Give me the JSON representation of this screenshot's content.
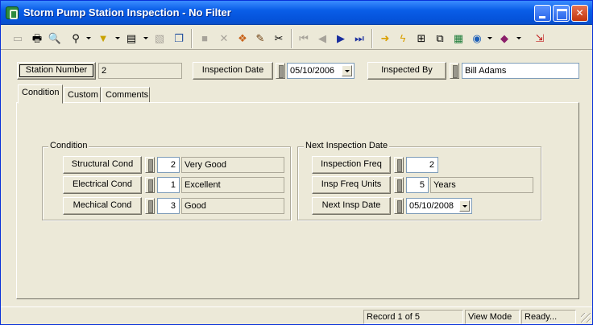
{
  "window": {
    "title": "Storm Pump Station Inspection - No Filter"
  },
  "toolbar": {
    "icons": [
      "save-icon",
      "print-icon",
      "print-preview-icon",
      "find-icon",
      "filter-icon",
      "view-icon",
      "properties-icon",
      "copy-form-icon",
      "delete-disabled-icon",
      "delete-icon",
      "attach-icon",
      "edit-icon",
      "cut-icon",
      "first-record-icon",
      "previous-record-icon",
      "next-record-icon",
      "last-record-icon",
      "new-record-icon",
      "lightning-icon",
      "structure-icon",
      "relations-icon",
      "map-icon",
      "globe-icon",
      "book-icon",
      "exit-icon"
    ]
  },
  "header": {
    "station_number_label": "Station Number",
    "station_number_value": "2",
    "inspection_date_label": "Inspection Date",
    "inspection_date_value": "05/10/2006",
    "inspected_by_label": "Inspected By",
    "inspected_by_value": "Bill Adams"
  },
  "tabs": [
    {
      "label": "Condition",
      "active": true
    },
    {
      "label": "Custom",
      "active": false
    },
    {
      "label": "Comments",
      "active": false
    }
  ],
  "condition": {
    "title": "Condition",
    "rows": [
      {
        "label": "Structural Cond",
        "code": "2",
        "text": "Very Good"
      },
      {
        "label": "Electrical Cond",
        "code": "1",
        "text": "Excellent"
      },
      {
        "label": "Mechical Cond",
        "code": "3",
        "text": "Good"
      }
    ]
  },
  "next_inspection": {
    "title": "Next Inspection Date",
    "freq_label": "Inspection Freq",
    "freq_value": "2",
    "units_label": "Insp Freq Units",
    "units_code": "5",
    "units_text": "Years",
    "next_label": "Next Insp Date",
    "next_value": "05/10/2008"
  },
  "status": {
    "record": "Record 1 of 5",
    "mode": "View Mode",
    "state": "Ready..."
  }
}
